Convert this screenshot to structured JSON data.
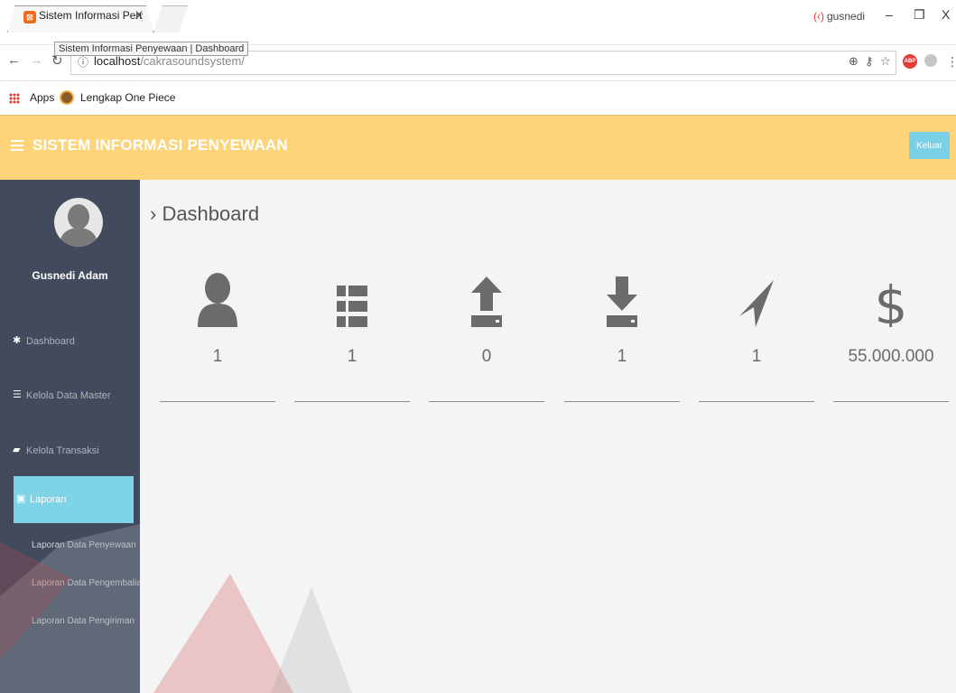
{
  "browser": {
    "tab_title": "Sistem Informasi Penyew",
    "tab_close": "X",
    "tooltip": "Sistem Informasi Penyewaan | Dashboard",
    "profile_name": "gusnedi",
    "url_host": "localhost",
    "url_path": "/cakrasoundsystem/",
    "bookmarks": {
      "apps": "Apps",
      "item1": "Lengkap One Piece"
    },
    "window": {
      "minimize": "–",
      "restore": "❐",
      "close": "X"
    }
  },
  "header": {
    "title": "SISTEM INFORMASI PENYEWAAN",
    "logout": "Keluar"
  },
  "sidebar": {
    "user_name": "Gusnedi Adam",
    "items": [
      {
        "label": "Dashboard",
        "icon": "dashboard-icon"
      },
      {
        "label": "Kelola Data Master",
        "icon": "list-icon"
      },
      {
        "label": "Kelola Transaksi",
        "icon": "book-icon"
      },
      {
        "label": "Laporan",
        "icon": "report-icon"
      }
    ],
    "submenu": [
      "Laporan Data Penyewaan",
      "Laporan Data Pengembalian",
      "Laporan Data Pengiriman"
    ]
  },
  "main": {
    "breadcrumb": "› Dashboard",
    "stats": [
      {
        "icon": "user-icon",
        "value": "1"
      },
      {
        "icon": "list-icon",
        "value": "1"
      },
      {
        "icon": "upload-icon",
        "value": "0"
      },
      {
        "icon": "download-icon",
        "value": "1"
      },
      {
        "icon": "send-icon",
        "value": "1"
      },
      {
        "icon": "dollar-icon",
        "value": "55.000.000"
      }
    ]
  },
  "colors": {
    "header_bg": "#fdd47a",
    "sidebar_bg": "#424a5d",
    "active_item": "#7fd3e6",
    "logout_button": "#79d0e7",
    "icon_gray": "#6b6b6b"
  }
}
